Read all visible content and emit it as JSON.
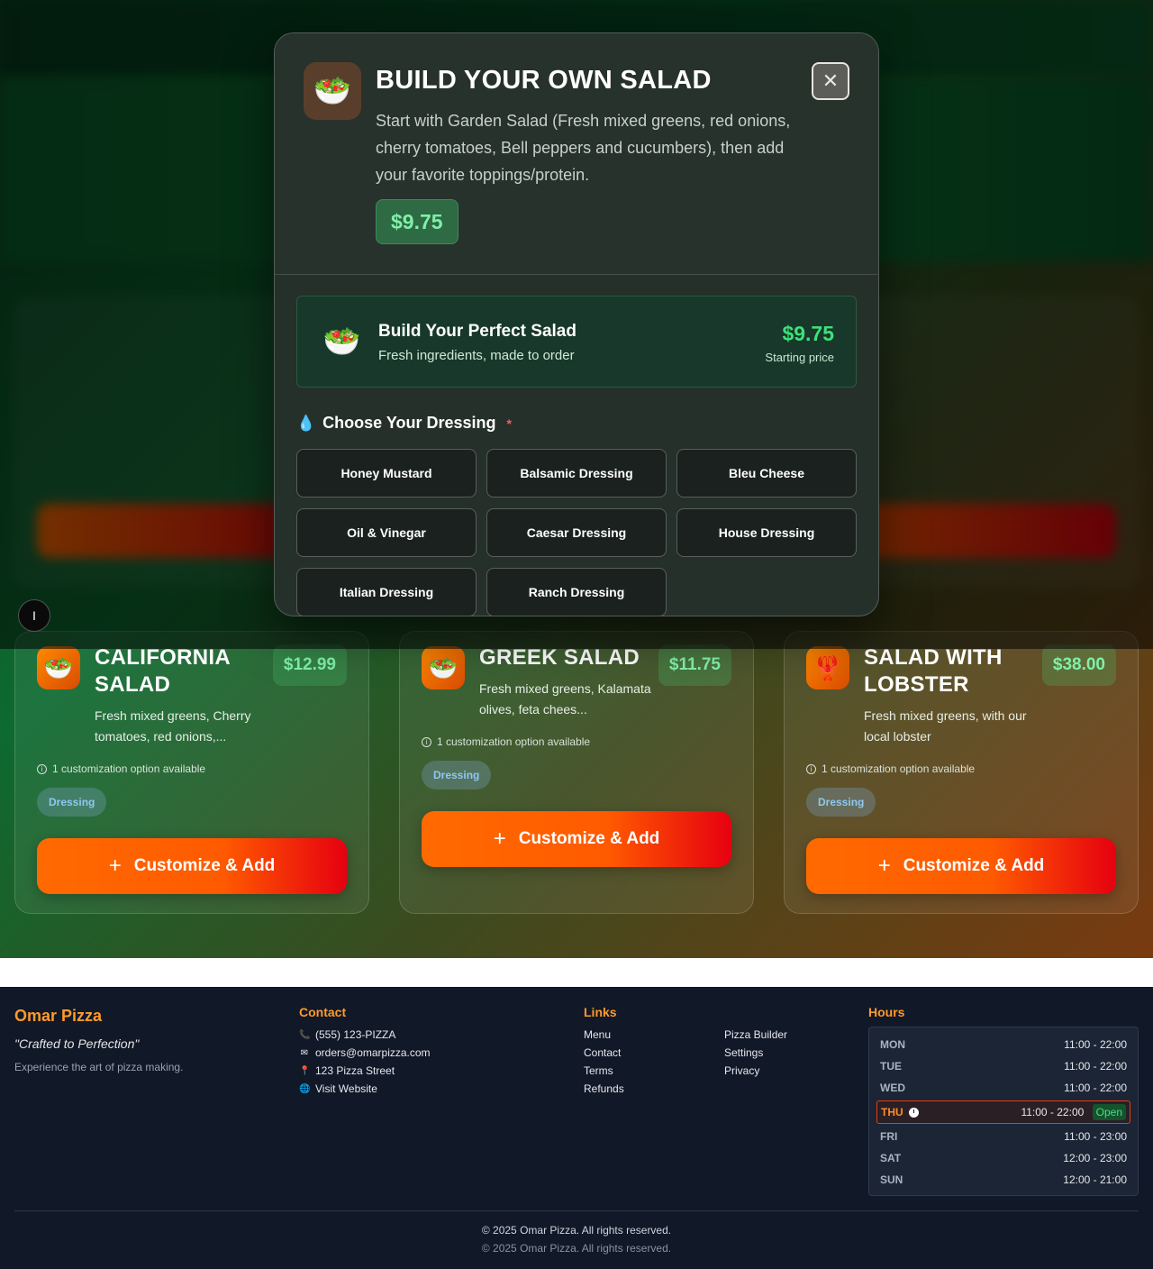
{
  "modal": {
    "title": "BUILD YOUR OWN SALAD",
    "description": "Start with Garden Salad (Fresh mixed greens, red onions, cherry tomatoes, Bell peppers and cucumbers), then add your favorite toppings/protein.",
    "price": "$9.75",
    "close_symbol": "✕",
    "icon": "salad-bowl-icon",
    "banner": {
      "title": "Build Your Perfect Salad",
      "subtitle": "Fresh ingredients, made to order",
      "price": "$9.75",
      "price_label": "Starting price"
    },
    "dressing_section": {
      "title": "Choose Your Dressing",
      "required_mark": "*",
      "options": [
        "Honey Mustard",
        "Balsamic Dressing",
        "Bleu Cheese",
        "Oil & Vinegar",
        "Caesar Dressing",
        "House Dressing",
        "Italian Dressing",
        "Ranch Dressing"
      ]
    }
  },
  "float_badge": "I",
  "cards": [
    {
      "title": "CALIFORNIA SALAD",
      "price": "$12.99",
      "description": "Fresh mixed greens, Cherry tomatoes, red onions,...",
      "info": "1 customization option available",
      "tag": "Dressing",
      "button": "Customize & Add",
      "icon": "salad-bowl-icon"
    },
    {
      "title": "GREEK SALAD",
      "price": "$11.75",
      "description": "Fresh mixed greens, Kalamata olives, feta chees...",
      "info": "1 customization option available",
      "tag": "Dressing",
      "button": "Customize & Add",
      "icon": "salad-bowl-icon"
    },
    {
      "title": "SALAD WITH LOBSTER",
      "price": "$38.00",
      "description": "Fresh mixed greens, with our local lobster",
      "info": "1 customization option available",
      "tag": "Dressing",
      "button": "Customize & Add",
      "icon": "lobster-icon"
    }
  ],
  "footer": {
    "brand": "Omar Pizza",
    "tagline": "\"Crafted to Perfection\"",
    "description": "Experience the art of pizza making.",
    "contact": {
      "title": "Contact",
      "phone": "(555) 123-PIZZA",
      "email": "orders@omarpizza.com",
      "address": "123 Pizza Street",
      "website": "Visit Website"
    },
    "links": {
      "title": "Links",
      "col1": [
        "Menu",
        "Contact",
        "Terms",
        "Refunds"
      ],
      "col2": [
        "Pizza Builder",
        "Settings",
        "Privacy"
      ]
    },
    "hours": {
      "title": "Hours",
      "rows": [
        {
          "day": "MON",
          "time": "11:00 - 22:00"
        },
        {
          "day": "TUE",
          "time": "11:00 - 22:00"
        },
        {
          "day": "WED",
          "time": "11:00 - 22:00"
        },
        {
          "day": "THU",
          "time": "11:00 - 22:00",
          "status": "Open"
        },
        {
          "day": "FRI",
          "time": "11:00 - 23:00"
        },
        {
          "day": "SAT",
          "time": "12:00 - 23:00"
        },
        {
          "day": "SUN",
          "time": "12:00 - 21:00"
        }
      ]
    },
    "copyright_1": "© 2025 Omar Pizza. All rights reserved.",
    "copyright_2": "© 2025 Omar Pizza. All rights reserved."
  },
  "colors": {
    "accent_orange": "#ff6a00",
    "accent_red": "#e60010",
    "price_green": "#7ff0a8",
    "footer_bg": "#111827"
  }
}
